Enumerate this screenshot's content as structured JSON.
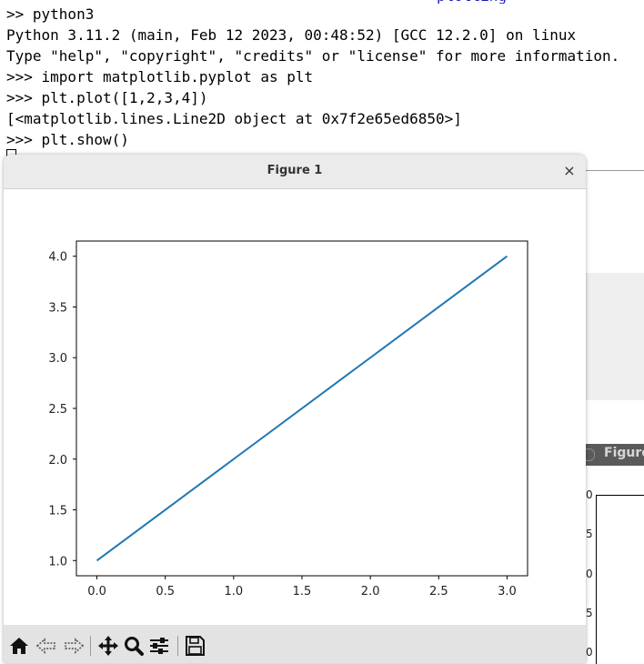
{
  "terminal": {
    "partial_top": "plotting",
    "lines": [
      ">> python3",
      "Python 3.11.2 (main, Feb 12 2023, 00:48:52) [GCC 12.2.0] on linux",
      "Type \"help\", \"copyright\", \"credits\" or \"license\" for more information.",
      ">>> import matplotlib.pyplot as plt",
      ">>> plt.plot([1,2,3,4])",
      "[<matplotlib.lines.Line2D object at 0x7f2e65ed6850>]",
      ">>> plt.show()"
    ]
  },
  "background_window": {
    "title": "Figure",
    "tick_labels": [
      "0",
      "5",
      "0",
      "5",
      "0"
    ]
  },
  "figure_window": {
    "title": "Figure 1",
    "close_glyph": "×",
    "toolbar": [
      {
        "name": "home-icon"
      },
      {
        "name": "back-icon"
      },
      {
        "name": "forward-icon"
      },
      {
        "name": "pan-icon"
      },
      {
        "name": "zoom-icon"
      },
      {
        "name": "subplots-config-icon"
      },
      {
        "name": "save-icon"
      }
    ]
  },
  "chart_data": {
    "type": "line",
    "x": [
      0,
      1,
      2,
      3
    ],
    "series": [
      {
        "values": [
          1,
          2,
          3,
          4
        ],
        "color": "#1f77b4"
      }
    ],
    "xlim": [
      -0.15,
      3.15
    ],
    "ylim": [
      0.85,
      4.15
    ],
    "xticks": [
      "0.0",
      "0.5",
      "1.0",
      "1.5",
      "2.0",
      "2.5",
      "3.0"
    ],
    "yticks": [
      "1.0",
      "1.5",
      "2.0",
      "2.5",
      "3.0",
      "3.5",
      "4.0"
    ],
    "title": "",
    "xlabel": "",
    "ylabel": "",
    "grid": false
  }
}
